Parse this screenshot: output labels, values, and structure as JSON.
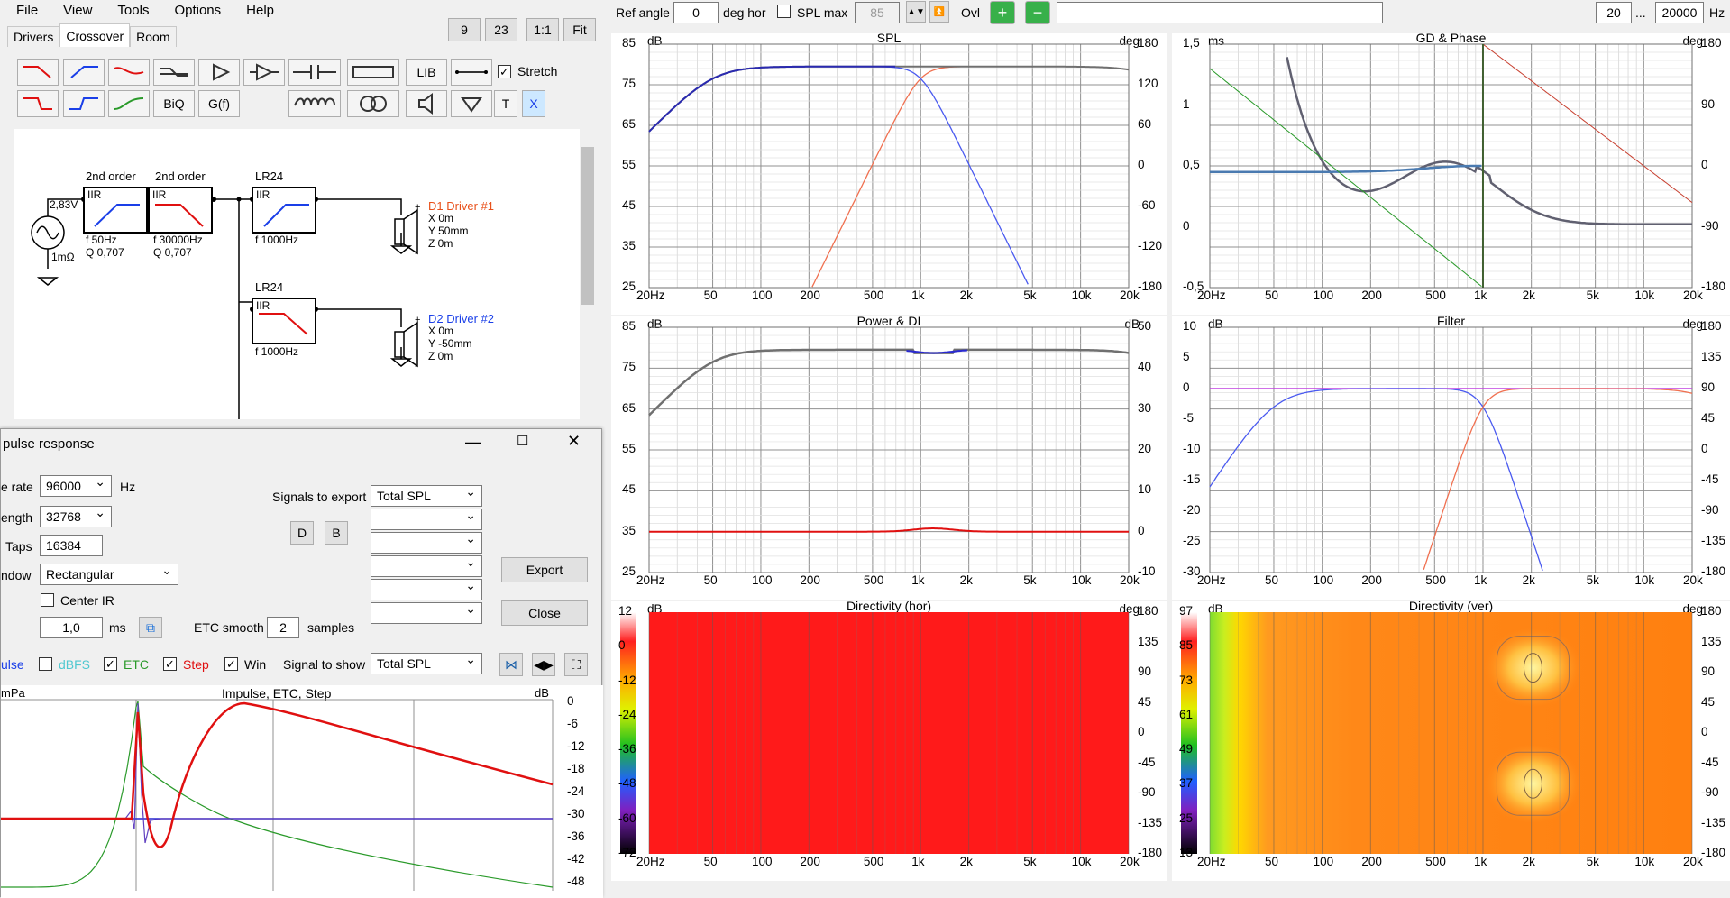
{
  "menu": [
    "File",
    "View",
    "Tools",
    "Options",
    "Help"
  ],
  "top_buttons": [
    "9",
    "23",
    "1:1",
    "Fit"
  ],
  "tabs": [
    "Drivers",
    "Crossover",
    "Room"
  ],
  "tool_buttons": {
    "lib": "LIB",
    "biq": "BiQ",
    "gf": "G(f)",
    "t": "T",
    "x": "X",
    "stretch": "Stretch"
  },
  "toolbar": {
    "ref_angle_label": "Ref angle",
    "ref_angle_value": "0",
    "deg_hor": "deg hor",
    "spl_max_label": "SPL max",
    "spl_max_value": "85",
    "ovl": "Ovl",
    "freq_from": "20",
    "ellipsis": "...",
    "freq_to": "20000",
    "hz": "Hz"
  },
  "schematic": {
    "source_voltage": "2,83V",
    "source_impedance": "1mΩ",
    "f1_order": "2nd order",
    "f1_type": "IIR",
    "f1_f": "f  50Hz",
    "f1_q": "Q  0,707",
    "f2_order": "2nd order",
    "f2_type": "IIR",
    "f2_f": "f  30000Hz",
    "f2_q": "Q  0,707",
    "f3_order": "LR24",
    "f3_type": "IIR",
    "f3_f": "f  1000Hz",
    "f4_order": "LR24",
    "f4_type": "IIR",
    "f4_f": "f  1000Hz",
    "d1_name": "D1 Driver #1",
    "d1_x": "X 0m",
    "d1_y": "Y 50mm",
    "d1_z": "Z 0m",
    "d2_name": "D2 Driver #2",
    "d2_x": "X 0m",
    "d2_y": "Y -50mm",
    "d2_z": "Z 0m",
    "plus": "+",
    "minus": "-"
  },
  "colors": {
    "d1": "#e8501a",
    "d2": "#1a3fe8",
    "tweeter_curve": "#f07050",
    "woofer_curve": "#4a5af0"
  },
  "charts": {
    "spl": {
      "title": "SPL",
      "left_unit": "dB",
      "right_unit": "deg",
      "y_left": [
        "85",
        "75",
        "65",
        "55",
        "45",
        "35",
        "25"
      ],
      "y_right": [
        "180",
        "120",
        "60",
        "0",
        "-60",
        "-120",
        "-180"
      ]
    },
    "gd": {
      "title": "GD & Phase",
      "left_unit": "ms",
      "right_unit": "deg",
      "y_left": [
        "1,5",
        "1",
        "0,5",
        "0",
        "-0,5"
      ],
      "y_right": [
        "180",
        "90",
        "0",
        "-90",
        "-180"
      ]
    },
    "power": {
      "title": "Power & DI",
      "left_unit": "dB",
      "right_unit": "dB",
      "y_left": [
        "85",
        "75",
        "65",
        "55",
        "45",
        "35",
        "25"
      ],
      "y_right": [
        "50",
        "40",
        "30",
        "20",
        "10",
        "0",
        "-10"
      ]
    },
    "filter": {
      "title": "Filter",
      "left_unit": "dB",
      "right_unit": "deg",
      "y_left": [
        "10",
        "5",
        "0",
        "-5",
        "-10",
        "-15",
        "-20",
        "-25",
        "-30"
      ],
      "y_right": [
        "180",
        "135",
        "90",
        "45",
        "0",
        "-45",
        "-90",
        "-135",
        "-180"
      ]
    },
    "dirh": {
      "title": "Directivity (hor)",
      "left_unit": "dB",
      "right_unit": "deg",
      "y_left": [
        "12",
        "0",
        "-12",
        "-24",
        "-36",
        "-48",
        "-60",
        "-72"
      ],
      "y_right": [
        "180",
        "135",
        "90",
        "45",
        "0",
        "-45",
        "-90",
        "-135",
        "-180"
      ]
    },
    "dirv": {
      "title": "Directivity (ver)",
      "left_unit": "dB",
      "right_unit": "deg",
      "y_left": [
        "97",
        "85",
        "73",
        "61",
        "49",
        "37",
        "25",
        "13"
      ],
      "y_right": [
        "180",
        "135",
        "90",
        "45",
        "0",
        "-45",
        "-90",
        "-135",
        "-180"
      ]
    },
    "x_ticks": [
      "20Hz",
      "50",
      "100",
      "200",
      "500",
      "1k",
      "2k",
      "5k",
      "10k",
      "20k"
    ]
  },
  "dialog": {
    "title": "pulse response",
    "rate_label": "e rate",
    "rate_value": "96000",
    "hz": "Hz",
    "length_label": "ength",
    "length_value": "32768",
    "taps_label": "Taps",
    "taps_value": "16384",
    "window_label": "ndow",
    "window_value": "Rectangular",
    "center_ir": "Center IR",
    "ms_value": "1,0",
    "ms": "ms",
    "etc_smooth": "ETC smooth",
    "etc_value": "2",
    "samples": "samples",
    "signals_to_export": "Signals to export",
    "export_values": [
      "Total SPL",
      "",
      "",
      "",
      "",
      ""
    ],
    "d": "D",
    "b": "B",
    "export": "Export",
    "close": "Close",
    "impulse": "ulse",
    "dbfs": "dBFS",
    "etc": "ETC",
    "step": "Step",
    "win": "Win",
    "signal_to_show": "Signal to show",
    "signal_value": "Total SPL",
    "plot_title": "Impulse, ETC, Step",
    "plot_left_unit": "mPa",
    "plot_right_unit": "dB",
    "plot_y_right": [
      "0",
      "-6",
      "-12",
      "-18",
      "-24",
      "-30",
      "-36",
      "-42",
      "-48"
    ]
  }
}
